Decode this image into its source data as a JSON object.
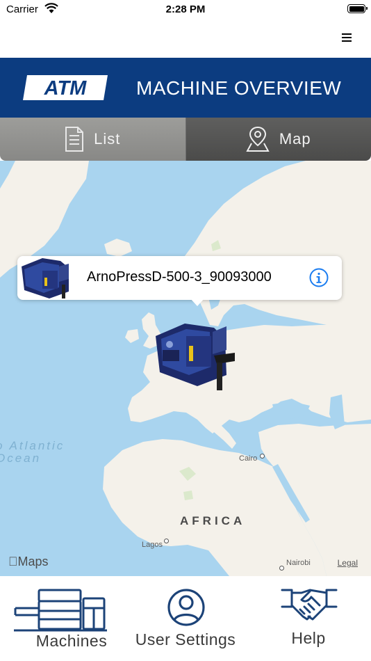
{
  "status_bar": {
    "carrier": "Carrier",
    "time": "2:28 PM"
  },
  "nav": {
    "menu_icon": "hamburger-menu-icon"
  },
  "header": {
    "logo_text": "ATM",
    "title": "MACHINE OVERVIEW",
    "background_color": "#0c3c80"
  },
  "view_tabs": [
    {
      "label": "List",
      "icon": "document-icon",
      "selected": false
    },
    {
      "label": "Map",
      "icon": "map-pin-icon",
      "selected": true
    }
  ],
  "map": {
    "ocean_label_line1": "o Atlantic",
    "ocean_label_line2": "Ocean",
    "continent_label": "AFRICA",
    "cities": [
      "Cairo",
      "Lagos",
      "Nairobi"
    ],
    "attribution": "Maps",
    "legal": "Legal"
  },
  "callout": {
    "title": "ArnoPressD-500-3_90093000",
    "info_icon": "info-icon"
  },
  "tab_bar": [
    {
      "label": "Machines",
      "icon": "machines-icon"
    },
    {
      "label": "User Settings",
      "icon": "user-icon"
    },
    {
      "label": "Help",
      "icon": "handshake-icon"
    }
  ],
  "colors": {
    "primary": "#0c3c80",
    "tab_icon": "#1c4378",
    "link_blue": "#1a7cf0"
  }
}
